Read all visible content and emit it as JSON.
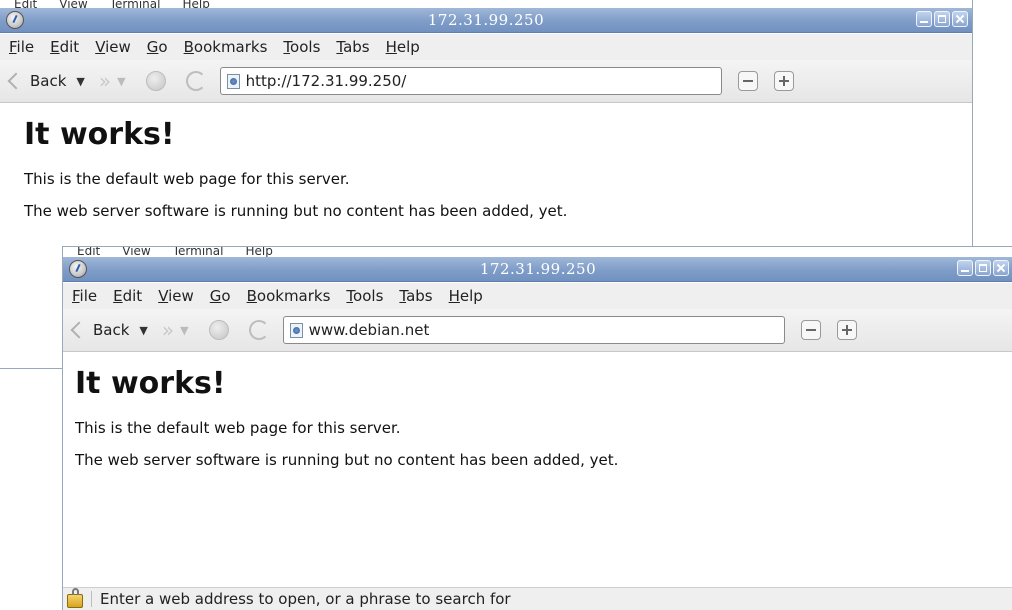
{
  "window_back": {
    "terminal_menu_peek": [
      "Edit",
      "View",
      "Terminal",
      "Help"
    ],
    "title": "172.31.99.250",
    "menu": [
      "File",
      "Edit",
      "View",
      "Go",
      "Bookmarks",
      "Tools",
      "Tabs",
      "Help"
    ],
    "toolbar": {
      "back_label": "Back"
    },
    "address": "http://172.31.99.250/",
    "page": {
      "heading": "It works!",
      "paragraph1": "This is the default web page for this server.",
      "paragraph2": "The web server software is running but no content has been added, yet."
    }
  },
  "window_front": {
    "terminal_menu_peek": [
      "Edit",
      "View",
      "Terminal",
      "Help"
    ],
    "title": "172.31.99.250",
    "menu": [
      "File",
      "Edit",
      "View",
      "Go",
      "Bookmarks",
      "Tools",
      "Tabs",
      "Help"
    ],
    "toolbar": {
      "back_label": "Back"
    },
    "address": "www.debian.net",
    "page": {
      "heading": "It works!",
      "paragraph1": "This is the default web page for this server.",
      "paragraph2": "The web server software is running but no content has been added, yet."
    },
    "status": "Enter a web address to open, or a phrase to search for"
  }
}
